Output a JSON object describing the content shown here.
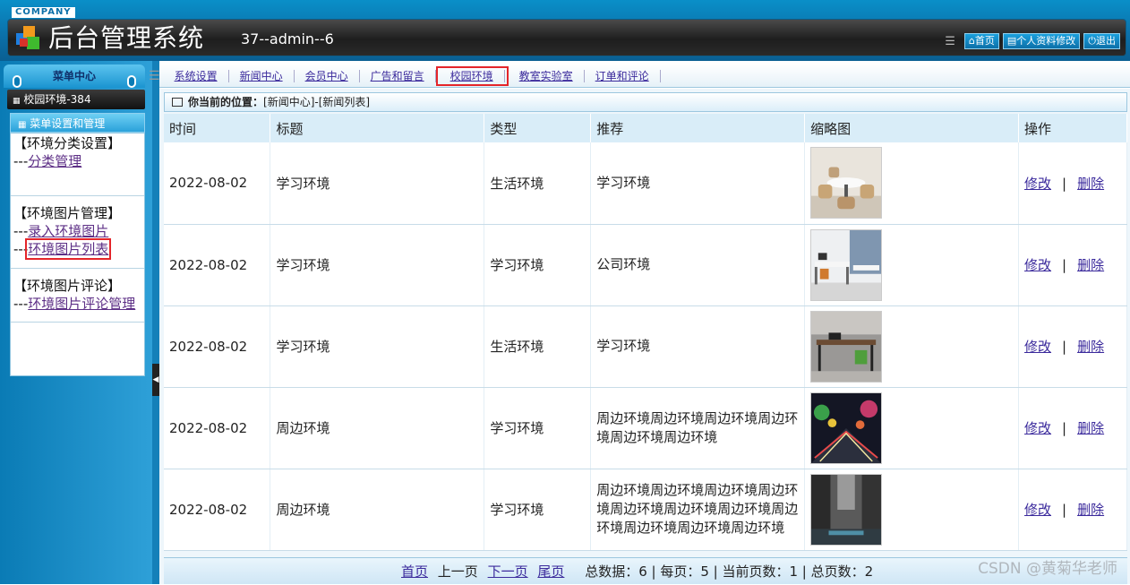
{
  "header": {
    "company": "COMPANY",
    "title": "后台管理系统",
    "subtitle": "37--admin--6",
    "links": {
      "home": "⌂首页",
      "profile": "▤个人资料修改",
      "logout": "⏻退出"
    }
  },
  "sidebar": {
    "menu_center": "菜单中心",
    "site": "校园环境-384",
    "submenu_title": "菜单设置和管理",
    "groups": [
      {
        "title": "【环境分类设置】",
        "items": [
          {
            "prefix": "---",
            "label": "分类管理"
          }
        ]
      },
      {
        "title": "【环境图片管理】",
        "items": [
          {
            "prefix": "---",
            "label": "录入环境图片"
          },
          {
            "prefix": "---",
            "label": "环境图片列表"
          }
        ]
      },
      {
        "title": "【环境图片评论】",
        "items": [
          {
            "prefix": "---",
            "label": "环境图片评论管理"
          }
        ]
      }
    ]
  },
  "nav": {
    "items": [
      "系统设置",
      "新闻中心",
      "会员中心",
      "广告和留言",
      "校园环境",
      "教室实验室",
      "订单和评论"
    ],
    "active": "校园环境"
  },
  "breadcrumb": {
    "label": "你当前的位置：",
    "path": "[新闻中心]-[新闻列表]"
  },
  "table": {
    "columns": [
      "时间",
      "标题",
      "类型",
      "推荐",
      "缩略图",
      "操作"
    ],
    "rows": [
      {
        "time": "2022-08-02",
        "title": "学习环境",
        "type": "生活环境",
        "recommend": "学习环境",
        "thumb": "meeting-room"
      },
      {
        "time": "2022-08-02",
        "title": "学习环境",
        "type": "学习环境",
        "recommend": "公司环境",
        "thumb": "office-desks"
      },
      {
        "time": "2022-08-02",
        "title": "学习环境",
        "type": "生活环境",
        "recommend": "学习环境",
        "thumb": "office-workspace"
      },
      {
        "time": "2022-08-02",
        "title": "周边环境",
        "type": "学习环境",
        "recommend": "周边环境周边环境周边环境周边环境周边环境周边环境",
        "thumb": "night-street"
      },
      {
        "time": "2022-08-02",
        "title": "周边环境",
        "type": "学习环境",
        "recommend": "周边环境周边环境周边环境周边环境周边环境周边环境周边环境周边环境周边环境周边环境周边环境",
        "thumb": "old-street-bw"
      }
    ],
    "edit_label": "修改",
    "delete_label": "删除",
    "separator": "|"
  },
  "pager": {
    "first": "首页",
    "prev": "上一页",
    "next": "下一页",
    "last": "尾页",
    "summary": "总数据：6 | 每页：5 | 当前页数：1 | 总页数：2"
  },
  "watermark": "CSDN @黄菊华老师",
  "colors": {
    "header_blue": "#0b6fa8",
    "link": "#3b2a9c",
    "highlight": "#e4252a"
  }
}
